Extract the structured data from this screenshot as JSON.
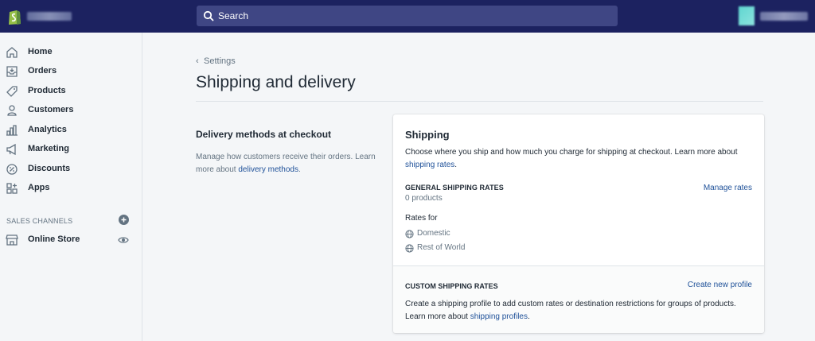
{
  "topbar": {
    "search_placeholder": "Search",
    "store_name": "",
    "user_name": ""
  },
  "sidebar": {
    "items": [
      {
        "label": "Home",
        "icon": "home-icon"
      },
      {
        "label": "Orders",
        "icon": "orders-icon"
      },
      {
        "label": "Products",
        "icon": "tag-icon"
      },
      {
        "label": "Customers",
        "icon": "person-icon"
      },
      {
        "label": "Analytics",
        "icon": "bar-chart-icon"
      },
      {
        "label": "Marketing",
        "icon": "megaphone-icon"
      },
      {
        "label": "Discounts",
        "icon": "discount-icon"
      },
      {
        "label": "Apps",
        "icon": "apps-icon"
      }
    ],
    "sales_channels_heading": "SALES CHANNELS",
    "online_store_label": "Online Store"
  },
  "main": {
    "breadcrumb": "Settings",
    "title": "Shipping and delivery",
    "section": {
      "title": "Delivery methods at checkout",
      "desc_prefix": "Manage how customers receive their orders. Learn more about ",
      "desc_link": "delivery methods",
      "desc_suffix": "."
    },
    "card": {
      "title": "Shipping",
      "desc_prefix": "Choose where you ship and how much you charge for shipping at checkout. Learn more about ",
      "desc_link": "shipping rates",
      "desc_suffix": ".",
      "general_title": "GENERAL SHIPPING RATES",
      "general_count": "0 products",
      "manage_rates": "Manage rates",
      "rates_for": "Rates for",
      "zones": [
        "Domestic",
        "Rest of World"
      ],
      "custom_title": "CUSTOM SHIPPING RATES",
      "create_profile": "Create new profile",
      "custom_desc_prefix": "Create a shipping profile to add custom rates or destination restrictions for groups of products. Learn more about ",
      "custom_desc_link": "shipping profiles",
      "custom_desc_suffix": "."
    }
  },
  "colors": {
    "topbar": "#1c2260",
    "link": "#1f5199",
    "brand_green": "#95bf47"
  }
}
